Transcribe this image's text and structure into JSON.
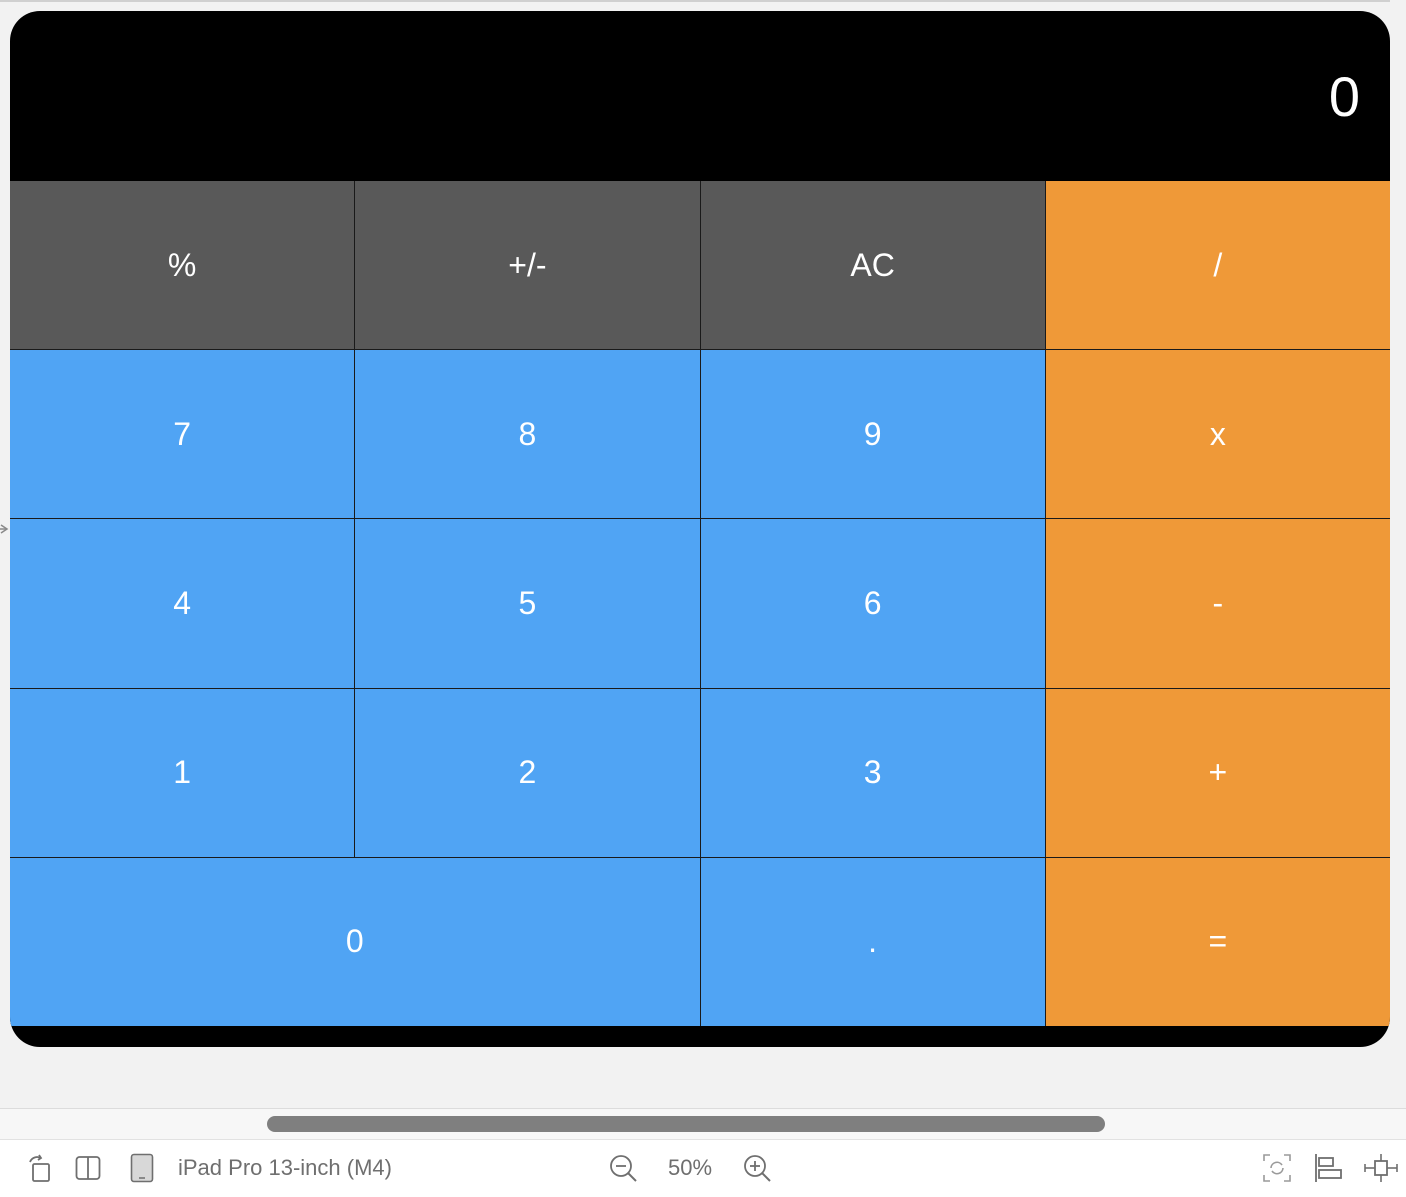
{
  "display": {
    "value": "0"
  },
  "keys": {
    "percent": "%",
    "negate": "+/-",
    "clear": "AC",
    "divide": "/",
    "seven": "7",
    "eight": "8",
    "nine": "9",
    "multiply": "x",
    "four": "4",
    "five": "5",
    "six": "6",
    "subtract": "-",
    "one": "1",
    "two": "2",
    "three": "3",
    "add": "+",
    "zero": "0",
    "decimal": ".",
    "equals": "="
  },
  "colors": {
    "function_key": "#595959",
    "number_key": "#50a4f4",
    "operator_key": "#ef9938",
    "device_background": "#000000"
  },
  "toolbar": {
    "device_name": "iPad Pro 13-inch (M4)",
    "zoom_level": "50%",
    "icons": [
      "rotate-icon",
      "split-view-icon",
      "ipad-device-icon",
      "zoom-out-icon",
      "zoom-in-icon",
      "refresh-preview-icon",
      "align-icon",
      "resize-icon"
    ]
  }
}
